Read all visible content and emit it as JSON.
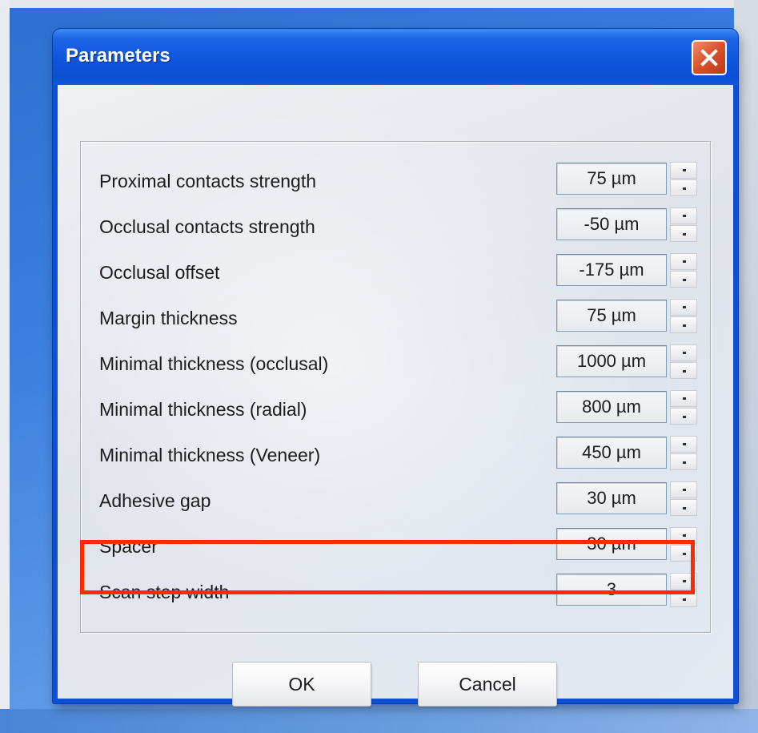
{
  "window": {
    "title": "Parameters"
  },
  "parameters": [
    {
      "label": "Proximal contacts strength",
      "value": "75 µm"
    },
    {
      "label": "Occlusal contacts strength",
      "value": "-50 µm"
    },
    {
      "label": "Occlusal offset",
      "value": "-175 µm"
    },
    {
      "label": "Margin thickness",
      "value": "75 µm"
    },
    {
      "label": "Minimal thickness (occlusal)",
      "value": "1000 µm"
    },
    {
      "label": "Minimal thickness (radial)",
      "value": "800 µm"
    },
    {
      "label": "Minimal thickness (Veneer)",
      "value": "450 µm"
    },
    {
      "label": "Adhesive gap",
      "value": "30 µm"
    },
    {
      "label": "Spacer",
      "value": "30 µm"
    },
    {
      "label": "Scan step width",
      "value": "3"
    }
  ],
  "buttons": {
    "ok_label": "OK",
    "cancel_label": "Cancel"
  },
  "colors": {
    "titlebar_blue": "#0f55dc",
    "close_red": "#d9502c",
    "highlight_red": "#ff2a00"
  },
  "highlighted_row": "Scan step width"
}
